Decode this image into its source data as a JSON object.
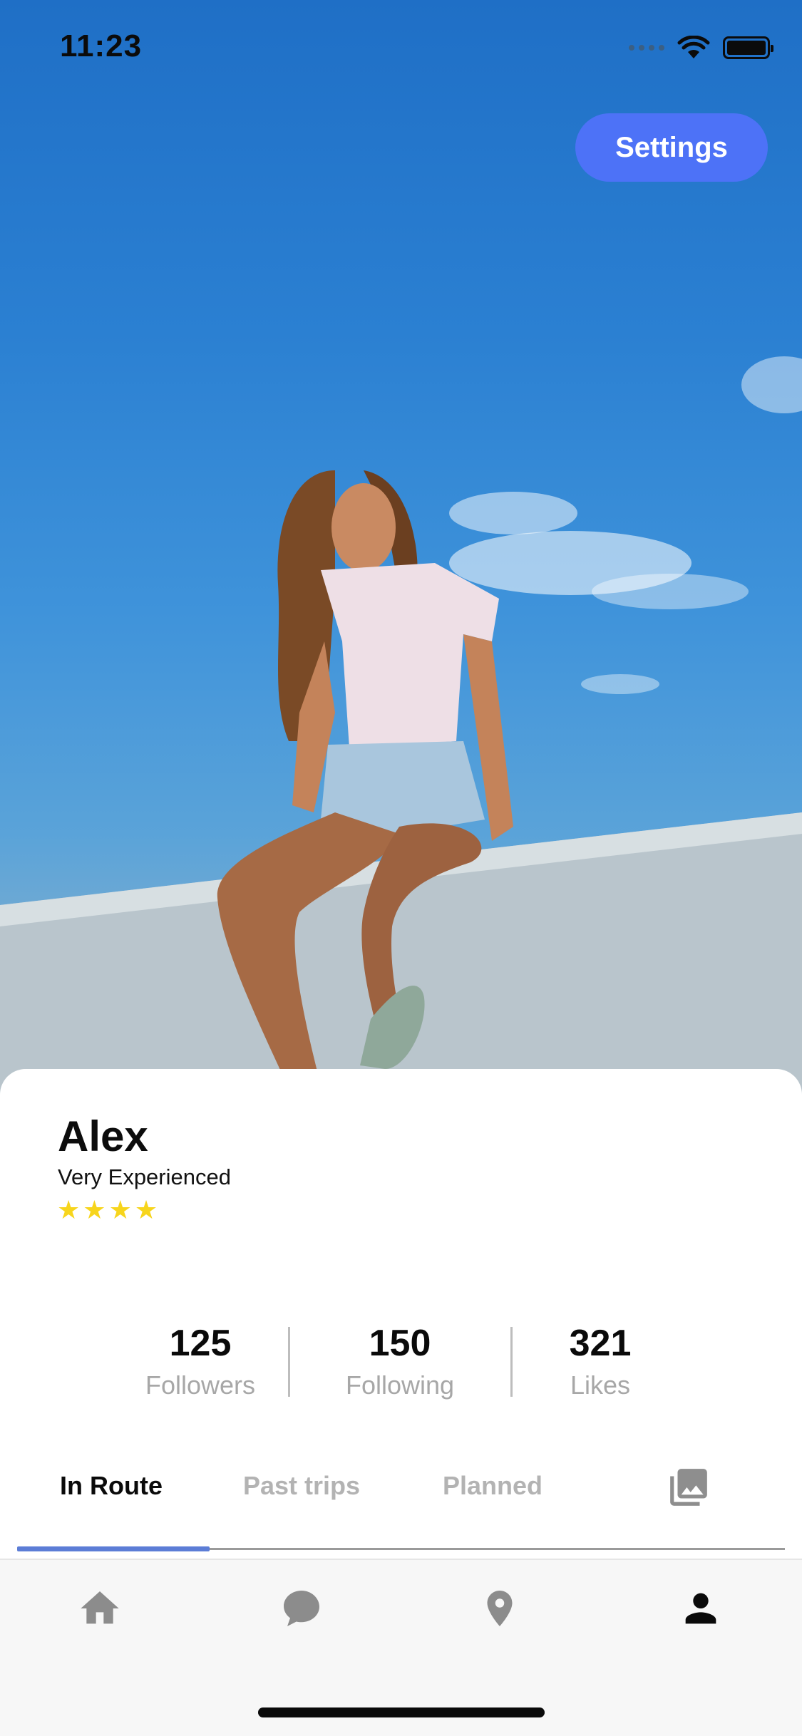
{
  "status_bar": {
    "time": "11:23"
  },
  "header": {
    "settings_label": "Settings"
  },
  "profile": {
    "name": "Alex",
    "level": "Very Experienced",
    "rating": 4
  },
  "stats": [
    {
      "value": "125",
      "label": "Followers"
    },
    {
      "value": "150",
      "label": "Following"
    },
    {
      "value": "321",
      "label": "Likes"
    }
  ],
  "tabs": [
    {
      "label": "In Route",
      "active": true
    },
    {
      "label": "Past trips",
      "active": false
    },
    {
      "label": "Planned",
      "active": false
    }
  ],
  "tab_icons": [
    "gallery-icon"
  ],
  "bottom_nav": [
    "home-icon",
    "chat-icon",
    "location-pin-icon",
    "profile-icon"
  ],
  "colors": {
    "accent": "#4d72f7",
    "tab_indicator": "#5c7dd6",
    "star": "#f7d51c",
    "muted_text": "#a7a7a7"
  }
}
